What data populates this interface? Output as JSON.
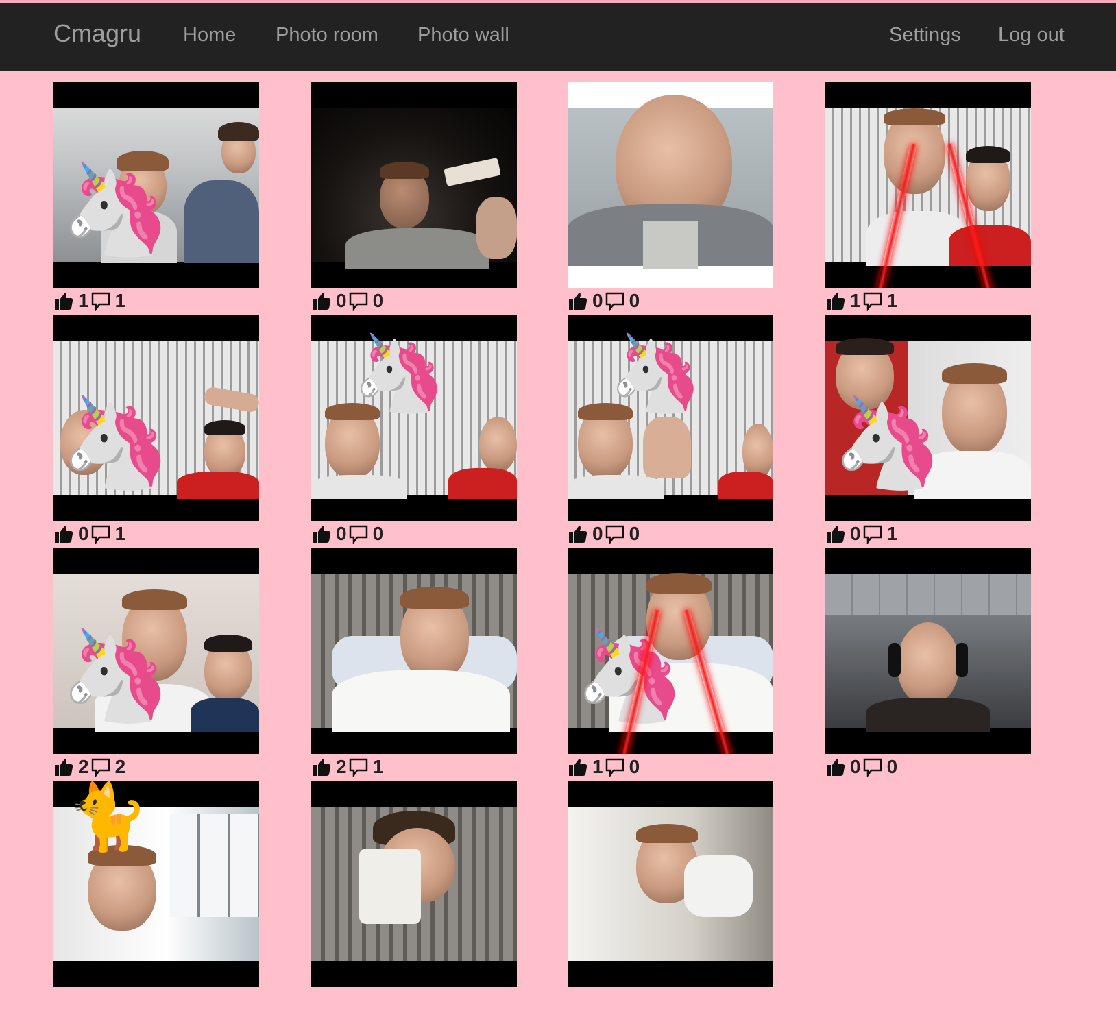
{
  "nav": {
    "brand": "Cmagru",
    "home": "Home",
    "photo_room": "Photo room",
    "photo_wall": "Photo wall",
    "settings": "Settings",
    "logout": "Log out"
  },
  "colors": {
    "page_background": "#ffc0cb",
    "navbar": "#222222",
    "nav_text": "#9d9d9d"
  },
  "photos": [
    {
      "likes": "1",
      "comments": "1",
      "sticker": "unicorn-dab",
      "scene": "office-two-people"
    },
    {
      "likes": "0",
      "comments": "0",
      "sticker": "none",
      "scene": "dark-room-snack"
    },
    {
      "likes": "0",
      "comments": "0",
      "sticker": "none",
      "scene": "closeup-face"
    },
    {
      "likes": "1",
      "comments": "1",
      "sticker": "laser-eyes",
      "scene": "two-guys-blinds"
    },
    {
      "likes": "0",
      "comments": "1",
      "sticker": "unicorn-dab",
      "scene": "blinds-pointing"
    },
    {
      "likes": "0",
      "comments": "0",
      "sticker": "flying-unicorn",
      "scene": "blinds-group"
    },
    {
      "likes": "0",
      "comments": "0",
      "sticker": "flying-unicorn",
      "scene": "blinds-wave"
    },
    {
      "likes": "0",
      "comments": "1",
      "sticker": "unicorn-dab",
      "scene": "two-guys-white"
    },
    {
      "likes": "2",
      "comments": "2",
      "sticker": "unicorn-dab",
      "scene": "two-guys-room"
    },
    {
      "likes": "2",
      "comments": "1",
      "sticker": "none",
      "scene": "guy-on-bed"
    },
    {
      "likes": "1",
      "comments": "0",
      "sticker": "unicorn-laser",
      "scene": "guy-on-bed-2"
    },
    {
      "likes": "0",
      "comments": "0",
      "sticker": "none",
      "scene": "headphones-office"
    },
    {
      "likes": "",
      "comments": "",
      "sticker": "cat",
      "scene": "window-room"
    },
    {
      "likes": "",
      "comments": "",
      "sticker": "none",
      "scene": "mug"
    },
    {
      "likes": "",
      "comments": "",
      "sticker": "none",
      "scene": "window-room-2"
    }
  ]
}
